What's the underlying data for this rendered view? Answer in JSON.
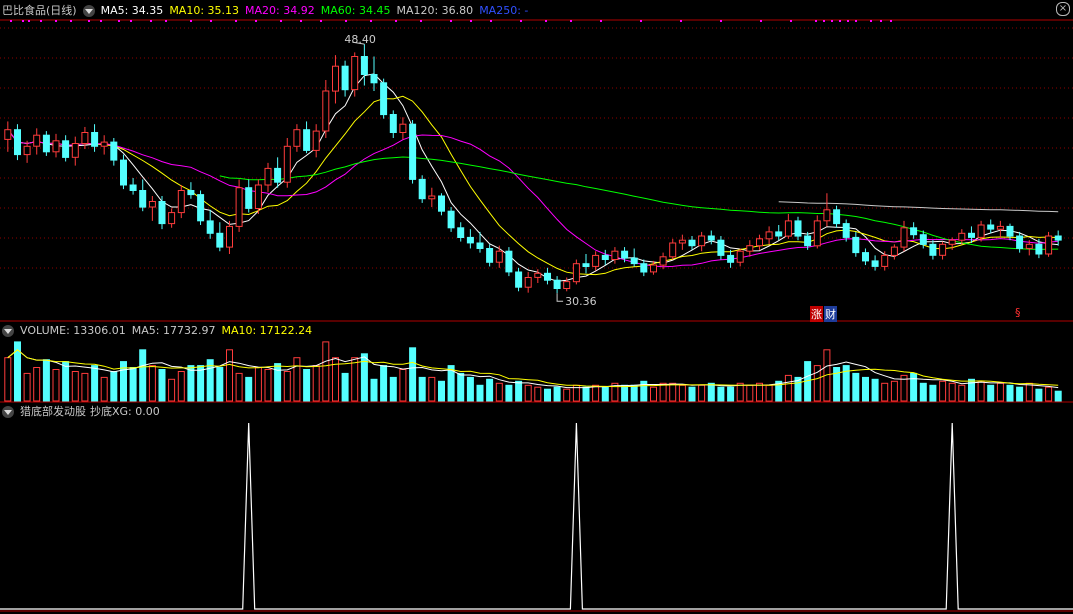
{
  "main_header": {
    "stock_name": "巴比食品(日线)",
    "ma5": "MA5: 34.35",
    "ma10": "MA10: 35.13",
    "ma20": "MA20: 34.92",
    "ma60": "MA60: 34.45",
    "ma120": "MA120: 36.80",
    "ma250": "MA250: -"
  },
  "volume_header": {
    "volume": "VOLUME: 13306.01",
    "ma5": "MA5: 17732.97",
    "ma10": "MA10: 17122.24"
  },
  "indicator_header": {
    "name": "猎底部发动股",
    "value": "抄底XG: 0.00"
  },
  "annotations": {
    "high_label": "48.40",
    "low_label": "30.36",
    "marker_zhang": "涨",
    "marker_cai": "财",
    "marker_s": "§"
  },
  "colors": {
    "up": "#ff3c3c",
    "down": "#54ffff",
    "ma5": "#ffffff",
    "ma10": "#ffff00",
    "ma20": "#ff00ff",
    "ma60": "#00ff00",
    "ma120": "#c8c8c8",
    "ma250": "#3050ff",
    "grid": "#8b0000"
  },
  "chart_data": [
    {
      "type": "candlestick",
      "title": "巴比食品(日线)",
      "annotations": {
        "high": 48.4,
        "low": 30.36
      },
      "candles": [
        [
          41.5,
          42.8,
          40.6,
          42.2
        ],
        [
          42.2,
          42.6,
          40.0,
          40.4
        ],
        [
          40.4,
          41.4,
          39.8,
          41.0
        ],
        [
          41.0,
          42.3,
          40.4,
          41.8
        ],
        [
          41.8,
          42.1,
          40.3,
          40.6
        ],
        [
          40.6,
          41.9,
          40.2,
          41.4
        ],
        [
          41.4,
          41.8,
          39.9,
          40.2
        ],
        [
          40.2,
          41.7,
          39.6,
          41.2
        ],
        [
          41.2,
          42.4,
          40.8,
          42.0
        ],
        [
          42.0,
          42.6,
          40.6,
          41.0
        ],
        [
          41.0,
          41.8,
          40.4,
          41.3
        ],
        [
          41.3,
          41.6,
          39.6,
          40.0
        ],
        [
          40.0,
          40.4,
          37.9,
          38.2
        ],
        [
          38.2,
          38.7,
          37.5,
          37.8
        ],
        [
          37.8,
          38.6,
          36.3,
          36.6
        ],
        [
          36.6,
          37.4,
          35.6,
          37.0
        ],
        [
          37.0,
          37.4,
          35.0,
          35.4
        ],
        [
          35.4,
          36.5,
          35.1,
          36.2
        ],
        [
          36.2,
          38.2,
          35.8,
          37.8
        ],
        [
          37.8,
          38.4,
          37.2,
          37.5
        ],
        [
          37.5,
          37.8,
          35.3,
          35.6
        ],
        [
          35.6,
          36.4,
          34.3,
          34.7
        ],
        [
          34.7,
          35.5,
          33.4,
          33.7
        ],
        [
          33.7,
          35.6,
          33.2,
          35.2
        ],
        [
          35.2,
          38.6,
          34.8,
          38.0
        ],
        [
          38.0,
          38.6,
          36.2,
          36.5
        ],
        [
          36.5,
          38.6,
          36.1,
          38.2
        ],
        [
          38.2,
          39.8,
          37.7,
          39.4
        ],
        [
          39.4,
          40.2,
          38.0,
          38.4
        ],
        [
          38.4,
          41.6,
          38.0,
          41.0
        ],
        [
          41.0,
          42.6,
          40.6,
          42.2
        ],
        [
          42.2,
          42.8,
          40.5,
          40.7
        ],
        [
          40.7,
          42.6,
          40.2,
          42.1
        ],
        [
          42.1,
          45.8,
          41.6,
          45.0
        ],
        [
          45.0,
          47.6,
          44.1,
          46.8
        ],
        [
          46.8,
          47.2,
          44.6,
          45.1
        ],
        [
          45.1,
          47.8,
          44.6,
          47.5
        ],
        [
          47.5,
          48.4,
          45.4,
          46.2
        ],
        [
          46.2,
          47.5,
          45.0,
          45.6
        ],
        [
          45.6,
          45.9,
          43.0,
          43.3
        ],
        [
          43.3,
          43.6,
          41.6,
          42.0
        ],
        [
          42.0,
          43.1,
          41.5,
          42.6
        ],
        [
          42.6,
          42.9,
          38.3,
          38.6
        ],
        [
          38.6,
          38.9,
          36.9,
          37.2
        ],
        [
          37.2,
          38.0,
          36.6,
          37.4
        ],
        [
          37.4,
          37.6,
          36.0,
          36.3
        ],
        [
          36.3,
          36.6,
          34.8,
          35.1
        ],
        [
          35.1,
          35.5,
          34.1,
          34.4
        ],
        [
          34.4,
          35.0,
          33.6,
          34.0
        ],
        [
          34.0,
          34.8,
          33.3,
          33.6
        ],
        [
          33.6,
          33.9,
          32.3,
          32.6
        ],
        [
          32.6,
          33.8,
          32.2,
          33.4
        ],
        [
          33.4,
          33.7,
          31.6,
          31.9
        ],
        [
          31.9,
          32.2,
          30.5,
          30.8
        ],
        [
          30.8,
          31.9,
          30.4,
          31.5
        ],
        [
          31.5,
          32.1,
          31.1,
          31.8
        ],
        [
          31.8,
          32.2,
          31.0,
          31.3
        ],
        [
          31.3,
          31.6,
          30.36,
          30.7
        ],
        [
          30.7,
          31.5,
          30.5,
          31.2
        ],
        [
          31.2,
          32.8,
          31.0,
          32.5
        ],
        [
          32.5,
          33.2,
          31.8,
          32.3
        ],
        [
          32.3,
          33.4,
          32.0,
          33.1
        ],
        [
          33.1,
          33.5,
          32.4,
          32.8
        ],
        [
          32.8,
          33.7,
          32.5,
          33.4
        ],
        [
          33.4,
          33.7,
          32.6,
          32.9
        ],
        [
          32.9,
          33.6,
          32.3,
          32.5
        ],
        [
          32.5,
          32.8,
          31.6,
          31.9
        ],
        [
          31.9,
          32.7,
          31.7,
          32.4
        ],
        [
          32.4,
          33.3,
          32.1,
          33.0
        ],
        [
          33.0,
          34.3,
          32.8,
          34.0
        ],
        [
          34.0,
          34.6,
          33.5,
          34.2
        ],
        [
          34.2,
          34.5,
          33.5,
          33.8
        ],
        [
          33.8,
          34.8,
          33.4,
          34.5
        ],
        [
          34.5,
          34.9,
          33.9,
          34.2
        ],
        [
          34.2,
          34.5,
          32.8,
          33.1
        ],
        [
          33.1,
          33.5,
          32.2,
          32.6
        ],
        [
          32.6,
          33.6,
          32.3,
          33.4
        ],
        [
          33.4,
          34.2,
          33.0,
          33.8
        ],
        [
          33.8,
          34.6,
          33.5,
          34.3
        ],
        [
          34.3,
          35.2,
          33.9,
          34.8
        ],
        [
          34.8,
          35.3,
          34.2,
          34.5
        ],
        [
          34.5,
          36.1,
          34.3,
          35.6
        ],
        [
          35.6,
          35.9,
          34.2,
          34.5
        ],
        [
          34.5,
          34.8,
          33.5,
          33.8
        ],
        [
          33.8,
          36.0,
          33.6,
          35.6
        ],
        [
          35.6,
          37.6,
          35.2,
          36.4
        ],
        [
          36.4,
          36.7,
          35.1,
          35.4
        ],
        [
          35.4,
          35.7,
          34.1,
          34.4
        ],
        [
          34.4,
          34.8,
          33.0,
          33.3
        ],
        [
          33.3,
          33.6,
          32.4,
          32.7
        ],
        [
          32.7,
          33.1,
          32.0,
          32.3
        ],
        [
          32.3,
          33.4,
          32.0,
          33.1
        ],
        [
          33.1,
          33.9,
          32.8,
          33.7
        ],
        [
          33.7,
          35.6,
          33.4,
          35.1
        ],
        [
          35.1,
          35.5,
          34.3,
          34.6
        ],
        [
          34.6,
          34.9,
          33.6,
          33.9
        ],
        [
          33.9,
          34.2,
          32.8,
          33.1
        ],
        [
          33.1,
          34.1,
          32.8,
          33.9
        ],
        [
          33.9,
          34.4,
          33.5,
          34.2
        ],
        [
          34.2,
          35.0,
          33.9,
          34.7
        ],
        [
          34.7,
          35.2,
          34.0,
          34.4
        ],
        [
          34.4,
          35.6,
          34.1,
          35.3
        ],
        [
          35.3,
          35.7,
          34.7,
          35.0
        ],
        [
          35.0,
          35.6,
          34.4,
          35.2
        ],
        [
          35.2,
          35.4,
          34.2,
          34.5
        ],
        [
          34.5,
          34.8,
          33.3,
          33.6
        ],
        [
          33.6,
          34.2,
          33.1,
          33.9
        ],
        [
          33.9,
          34.3,
          32.9,
          33.2
        ],
        [
          33.2,
          34.8,
          33.0,
          34.5
        ],
        [
          34.5,
          34.9,
          33.8,
          34.2
        ]
      ]
    },
    {
      "type": "bar",
      "title": "VOLUME",
      "values": [
        22,
        30,
        14,
        17,
        21,
        16,
        20,
        15,
        14,
        18,
        12,
        15,
        20,
        17,
        26,
        18,
        16,
        11,
        15,
        18,
        18,
        21,
        17,
        26,
        14,
        12,
        17,
        16,
        19,
        15,
        22,
        16,
        18,
        30,
        22,
        14,
        22,
        24,
        11,
        18,
        12,
        16,
        27,
        12,
        12,
        10,
        18,
        14,
        12,
        8,
        11,
        9,
        8,
        10,
        8,
        7,
        6,
        7,
        6,
        8,
        7,
        8,
        7,
        9,
        8,
        8,
        10,
        7,
        9,
        9,
        8,
        7,
        8,
        9,
        7,
        7,
        9,
        8,
        9,
        8,
        10,
        13,
        12,
        20,
        18,
        26,
        17,
        18,
        14,
        12,
        11,
        9,
        10,
        13,
        14,
        9,
        8,
        10,
        9,
        8,
        11,
        10,
        8,
        9,
        8,
        7,
        9,
        6,
        7,
        5
      ],
      "ma5_label": "MA5: 17732.97",
      "ma10_label": "MA10: 17122.24"
    },
    {
      "type": "line",
      "title": "猎底部发动股",
      "series": [
        {
          "name": "抄底XG",
          "spikes_at_candle": [
            25,
            59,
            98
          ]
        }
      ]
    }
  ]
}
